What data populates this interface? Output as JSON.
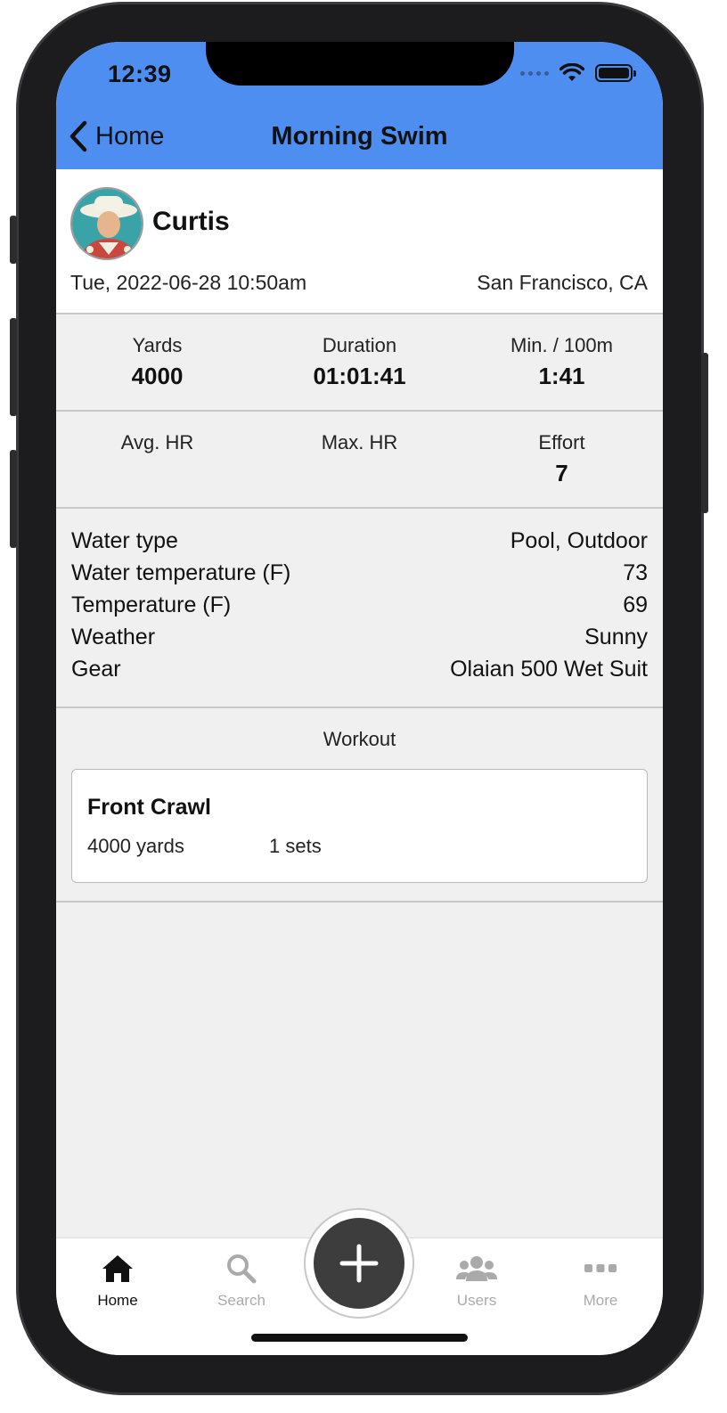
{
  "status_bar": {
    "time": "12:39"
  },
  "nav": {
    "back_label": "Home",
    "title": "Morning Swim"
  },
  "profile": {
    "name": "Curtis",
    "date": "Tue, 2022-06-28 10:50am",
    "location": "San Francisco, CA"
  },
  "stats_row1": [
    {
      "label": "Yards",
      "value": "4000"
    },
    {
      "label": "Duration",
      "value": "01:01:41"
    },
    {
      "label": "Min. / 100m",
      "value": "1:41"
    }
  ],
  "stats_row2": [
    {
      "label": "Avg. HR",
      "value": ""
    },
    {
      "label": "Max. HR",
      "value": ""
    },
    {
      "label": "Effort",
      "value": "7"
    }
  ],
  "details": [
    {
      "label": "Water type",
      "value": "Pool, Outdoor"
    },
    {
      "label": "Water temperature (F)",
      "value": "73"
    },
    {
      "label": "Temperature (F)",
      "value": "69"
    },
    {
      "label": "Weather",
      "value": "Sunny"
    },
    {
      "label": "Gear",
      "value": "Olaian 500 Wet Suit"
    }
  ],
  "workout": {
    "heading": "Workout",
    "items": [
      {
        "name": "Front Crawl",
        "distance": "4000 yards",
        "sets": "1 sets"
      }
    ]
  },
  "tabbar": {
    "tabs": [
      {
        "label": "Home",
        "icon": "home-icon",
        "active": true
      },
      {
        "label": "Search",
        "icon": "search-icon",
        "active": false
      },
      {
        "label": "Users",
        "icon": "users-icon",
        "active": false
      },
      {
        "label": "More",
        "icon": "more-icon",
        "active": false
      }
    ],
    "fab_icon": "plus-icon"
  },
  "colors": {
    "header_blue": "#4e8ef0",
    "background": "#f0f0f0",
    "fab": "#3d3d3d"
  }
}
